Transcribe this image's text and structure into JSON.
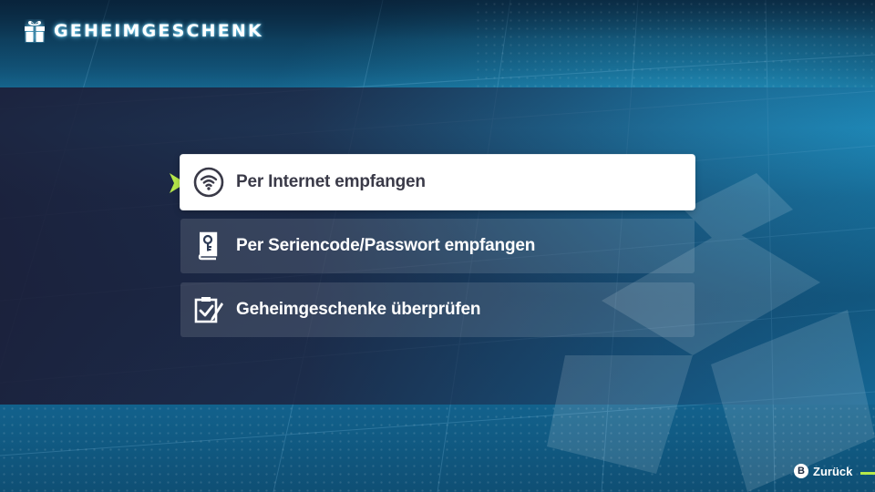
{
  "header": {
    "title": "GEHEIMGESCHENK",
    "title_icon": "gift-icon"
  },
  "menu": {
    "selected_index": 0,
    "items": [
      {
        "label": "Per Internet empfangen",
        "icon": "wifi-icon"
      },
      {
        "label": "Per Seriencode/Passwort empfangen",
        "icon": "key-card-icon"
      },
      {
        "label": "Geheimgeschenke überprüfen",
        "icon": "clipboard-check-icon"
      }
    ]
  },
  "footer": {
    "back_button_glyph": "B",
    "back_label": "Zurück"
  },
  "colors": {
    "accent_green": "#b6e84a",
    "selected_bg": "#ffffff",
    "selected_text": "#3a3a48"
  }
}
